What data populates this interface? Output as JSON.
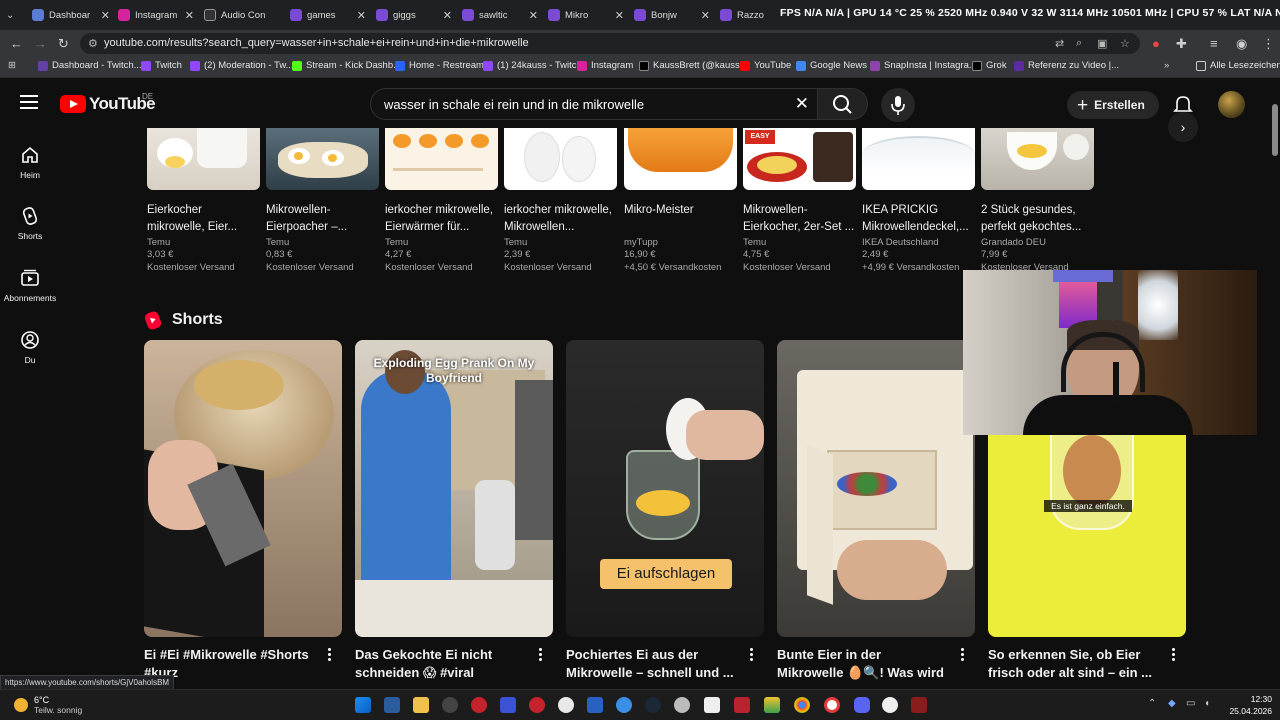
{
  "browser": {
    "tabs": [
      {
        "label": "Dashboar",
        "color": "#5a7bd6"
      },
      {
        "label": "Instagram",
        "color": "#d6249f"
      },
      {
        "label": "Audio Con",
        "color": "#333333"
      },
      {
        "label": "games",
        "color": "#7b4bd6"
      },
      {
        "label": "giggs",
        "color": "#7b4bd6"
      },
      {
        "label": "sawltic",
        "color": "#7b4bd6"
      },
      {
        "label": "Mikro",
        "color": "#7b4bd6"
      },
      {
        "label": "Bonjw",
        "color": "#7b4bd6"
      },
      {
        "label": "Razzo",
        "color": "#7b4bd6"
      }
    ],
    "overlay_stats": "FPS N/A N/A | GPU 14 °C 25 % 2520 MHz 0.940 V 32 W 3114 MHz 10501 MHz | CPU 57 % LAT N/A N/A",
    "url": "youtube.com/results?search_query=wasser+in+schale+ei+rein+und+in+die+mikrowelle",
    "bookmarks": [
      {
        "label": "Dashboard - Twitch...",
        "color": "#6441a5"
      },
      {
        "label": "Twitch",
        "color": "#9146ff"
      },
      {
        "label": "(2) Moderation - Tw...",
        "color": "#9146ff"
      },
      {
        "label": "Stream - Kick Dashb...",
        "color": "#53fc18"
      },
      {
        "label": "Home - Restream",
        "color": "#2962ff"
      },
      {
        "label": "(1) 24kauss - Twitch",
        "color": "#9146ff"
      },
      {
        "label": "Instagram",
        "color": "#d6249f"
      },
      {
        "label": "KaussBrett (@kauss...",
        "color": "#000000"
      },
      {
        "label": "YouTube",
        "color": "#ff0000"
      },
      {
        "label": "Google News",
        "color": "#4285f4"
      },
      {
        "label": "SnapInsta | Instagra...",
        "color": "#8e44ad"
      },
      {
        "label": "Grok",
        "color": "#000000"
      },
      {
        "label": "Referenz zu Video |...",
        "color": "#5a2ca0"
      }
    ],
    "all_bookmarks": "Alle Lesezeichen"
  },
  "youtube": {
    "logo_text": "YouTube",
    "country": "DE",
    "search_query": "wasser in schale ei rein und in die mikrowelle",
    "create_label": "Erstellen",
    "nav": [
      {
        "label": "Heim",
        "icon": "home-icon"
      },
      {
        "label": "Shorts",
        "icon": "shorts-icon"
      },
      {
        "label": "Abonnements",
        "icon": "subscriptions-icon"
      },
      {
        "label": "Du",
        "icon": "you-icon"
      }
    ],
    "products": [
      {
        "title": "Eierkocher mikrowelle, Eier...",
        "seller": "Temu",
        "price": "3,03 €",
        "shipping": "Kostenloser Versand"
      },
      {
        "title": "Mikrowellen-Eierpoacher –...",
        "seller": "Temu",
        "price": "0,83 €",
        "shipping": "Kostenloser Versand"
      },
      {
        "title": "ierkocher mikrowelle, Eierwärmer für...",
        "seller": "Temu",
        "price": "4,27 €",
        "shipping": "Kostenloser Versand"
      },
      {
        "title": "ierkocher mikrowelle, Mikrowellen...",
        "seller": "Temu",
        "price": "2,39 €",
        "shipping": "Kostenloser Versand"
      },
      {
        "title": "Mikro-Meister",
        "seller": "myTupp",
        "price": "16,90 €",
        "shipping": "+4,50 € Versandkosten"
      },
      {
        "title": "Mikrowellen-Eierkocher, 2er-Set ...",
        "seller": "Temu",
        "price": "4,75 €",
        "shipping": "Kostenloser Versand"
      },
      {
        "title": "IKEA PRICKIG Mikrowellendeckel,...",
        "seller": "IKEA Deutschland",
        "price": "2,49 €",
        "shipping": "+4,99 € Versandkosten"
      },
      {
        "title": "2 Stück gesundes, perfekt gekochtes...",
        "seller": "Grandado DEU",
        "price": "7,99 €",
        "shipping": "Kostenloser Versand"
      }
    ],
    "shorts_heading": "Shorts",
    "shorts": [
      {
        "title": "Ei #Ei #Mikrowelle #Shorts #kurz",
        "overlay": ""
      },
      {
        "title": "Das Gekochte Ei nicht schneiden 😱 #viral",
        "overlay": "Exploding Egg Prank On My Boyfriend"
      },
      {
        "title": "Pochiertes Ei aus der Mikrowelle – schnell und ...",
        "overlay": "Ei aufschlagen"
      },
      {
        "title": "Bunte Eier in der Mikrowelle 🥚🔍! Was wird passiere...",
        "overlay": ""
      },
      {
        "title": "So erkennen Sie, ob Eier frisch oder alt sind – ein ...",
        "overlay": "Es ist ganz einfach."
      }
    ]
  },
  "status_url": "https://www.youtube.com/shorts/GjV0aholsBM",
  "taskbar": {
    "weather_temp": "6°C",
    "weather_desc": "Teilw. sonnig",
    "time": "12:30",
    "date": "25.04.2026"
  }
}
